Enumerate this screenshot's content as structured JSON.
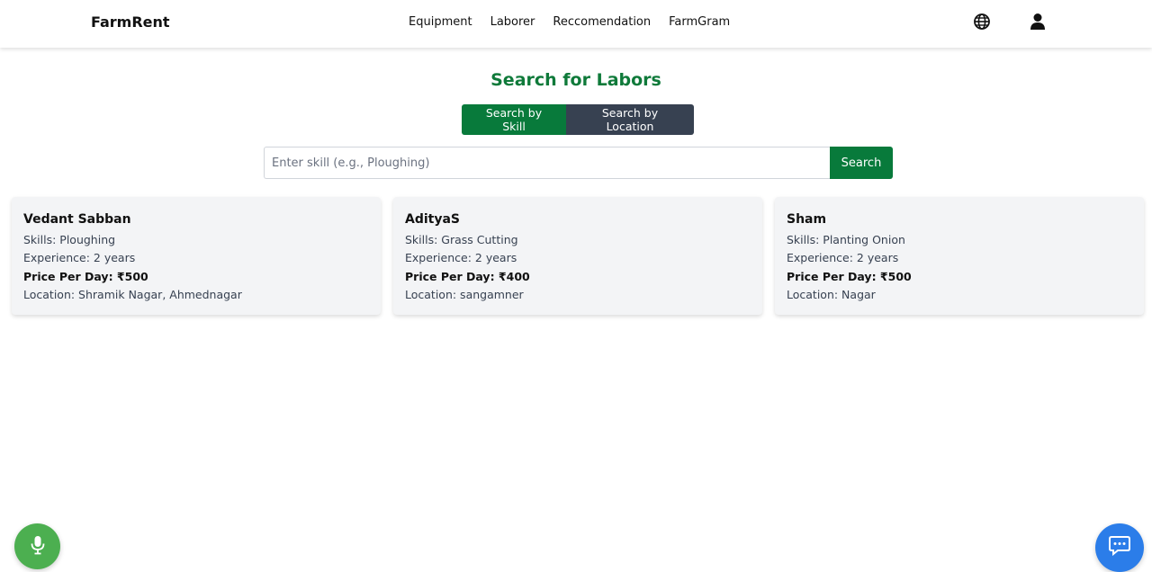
{
  "nav": {
    "brand": "FarmRent",
    "links": [
      "Equipment",
      "Laborer",
      "Reccomendation",
      "FarmGram"
    ],
    "icons": {
      "language": "globe-icon",
      "profile": "user-icon"
    }
  },
  "search": {
    "title": "Search for Labors",
    "mode_skill": "Search by Skill",
    "mode_location": "Search by Location",
    "active_mode": "Search by Skill",
    "placeholder": "Enter skill (e.g., Ploughing)",
    "value": "",
    "button": "Search"
  },
  "laborers": [
    {
      "name": "Vedant Sabban",
      "skills": "Skills: Ploughing",
      "experience": "Experience: 2 years",
      "price": "Price Per Day: ₹500",
      "location": "Location: Shramik Nagar, Ahmednagar"
    },
    {
      "name": "AdityaS",
      "skills": "Skills: Grass Cutting",
      "experience": "Experience: 2 years",
      "price": "Price Per Day: ₹400",
      "location": "Location: sangamner"
    },
    {
      "name": "Sham",
      "skills": "Skills: Planting Onion",
      "experience": "Experience: 2 years",
      "price": "Price Per Day: ₹500",
      "location": "Location: Nagar"
    }
  ],
  "floating": {
    "voice": "microphone-icon",
    "chat": "chat-icon"
  },
  "colors": {
    "primary_green": "#087a3b",
    "title_green": "#0f7a3a",
    "dark_button": "#374151",
    "card_bg": "#f3f4f6",
    "mic_green": "#4caf50",
    "chat_blue": "#2b7de9"
  }
}
